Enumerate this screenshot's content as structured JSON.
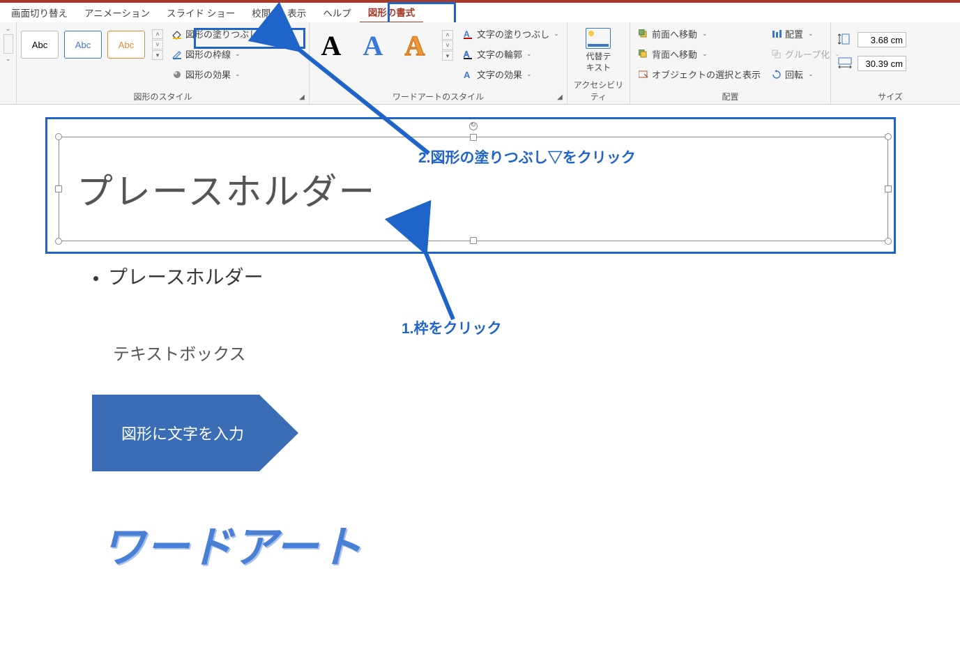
{
  "tabs": {
    "transition": "画面切り替え",
    "animation": "アニメーション",
    "slideshow": "スライド ショー",
    "review": "校閲",
    "view": "表示",
    "help": "ヘルプ",
    "shape_format": "図形の書式"
  },
  "ribbon": {
    "shape_styles": {
      "label": "図形のスタイル",
      "preset": "Abc",
      "fill": "図形の塗りつぶし",
      "outline": "図形の枠線",
      "effects": "図形の効果"
    },
    "wordart_styles": {
      "label": "ワードアートのスタイル",
      "preset": "A",
      "text_fill": "文字の塗りつぶし",
      "text_outline": "文字の輪郭",
      "text_effects": "文字の効果"
    },
    "accessibility": {
      "label": "アクセシビリティ",
      "alt_text1": "代替テ",
      "alt_text2": "キスト"
    },
    "arrange": {
      "label": "配置",
      "bring_forward": "前面へ移動",
      "send_backward": "背面へ移動",
      "selection_pane": "オブジェクトの選択と表示",
      "align": "配置",
      "group": "グループ化",
      "rotate": "回転"
    },
    "size": {
      "label": "サイズ",
      "height": "3.68 cm",
      "width": "30.39 cm"
    }
  },
  "slide": {
    "placeholder_text": "プレースホルダー",
    "bullet_text": "プレースホルダー",
    "textbox_label": "テキストボックス",
    "arrow_shape_text": "図形に文字を入力",
    "wordart_text": "ワードアート"
  },
  "annotations": {
    "step1": "1.枠をクリック",
    "step2": "2.図形の塗りつぶし▽をクリック"
  }
}
